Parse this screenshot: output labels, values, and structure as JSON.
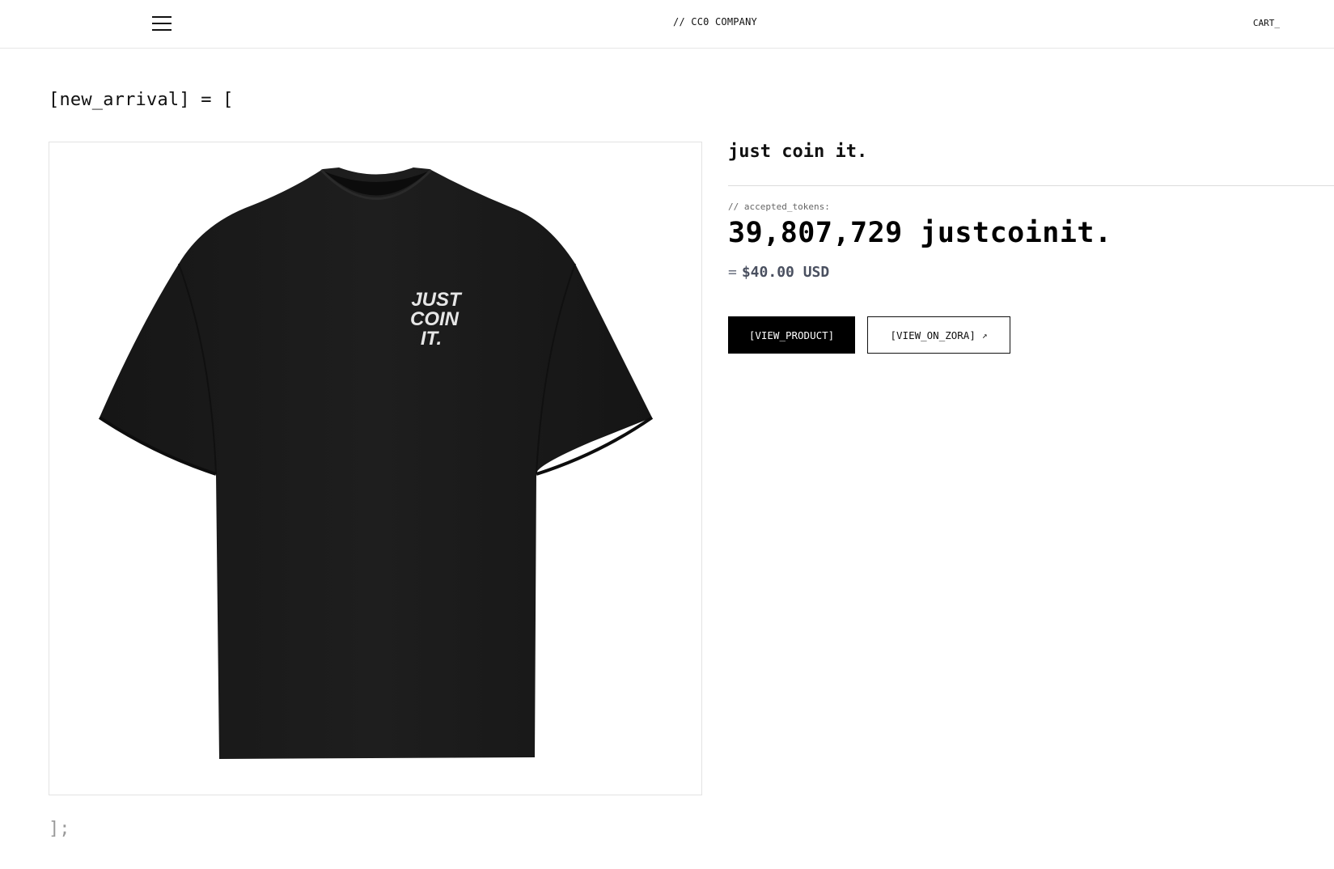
{
  "header": {
    "brand": "// CC0 COMPANY",
    "cart_label": "CART_",
    "menu_icon": "hamburger-menu-icon"
  },
  "section": {
    "open_label": "[new_arrival] = [",
    "close_label": "];"
  },
  "product": {
    "image_alt": "black t-shirt with JUST COIN IT. print",
    "print_text": [
      "JUST",
      "COIN",
      "IT."
    ],
    "title": "just coin it.",
    "tokens_label": "// accepted_tokens:",
    "token_amount": "39,807,729 justcoinit.",
    "usd_prefix": "=",
    "usd_price": "$40.00 USD",
    "view_product_label": "[VIEW_PRODUCT]",
    "view_on_zora_label": "[VIEW_ON_ZORA]",
    "external_icon": "↗"
  },
  "colors": {
    "accent": "#000000",
    "muted_price": "#4a5060",
    "divider": "#dcdcdc"
  }
}
